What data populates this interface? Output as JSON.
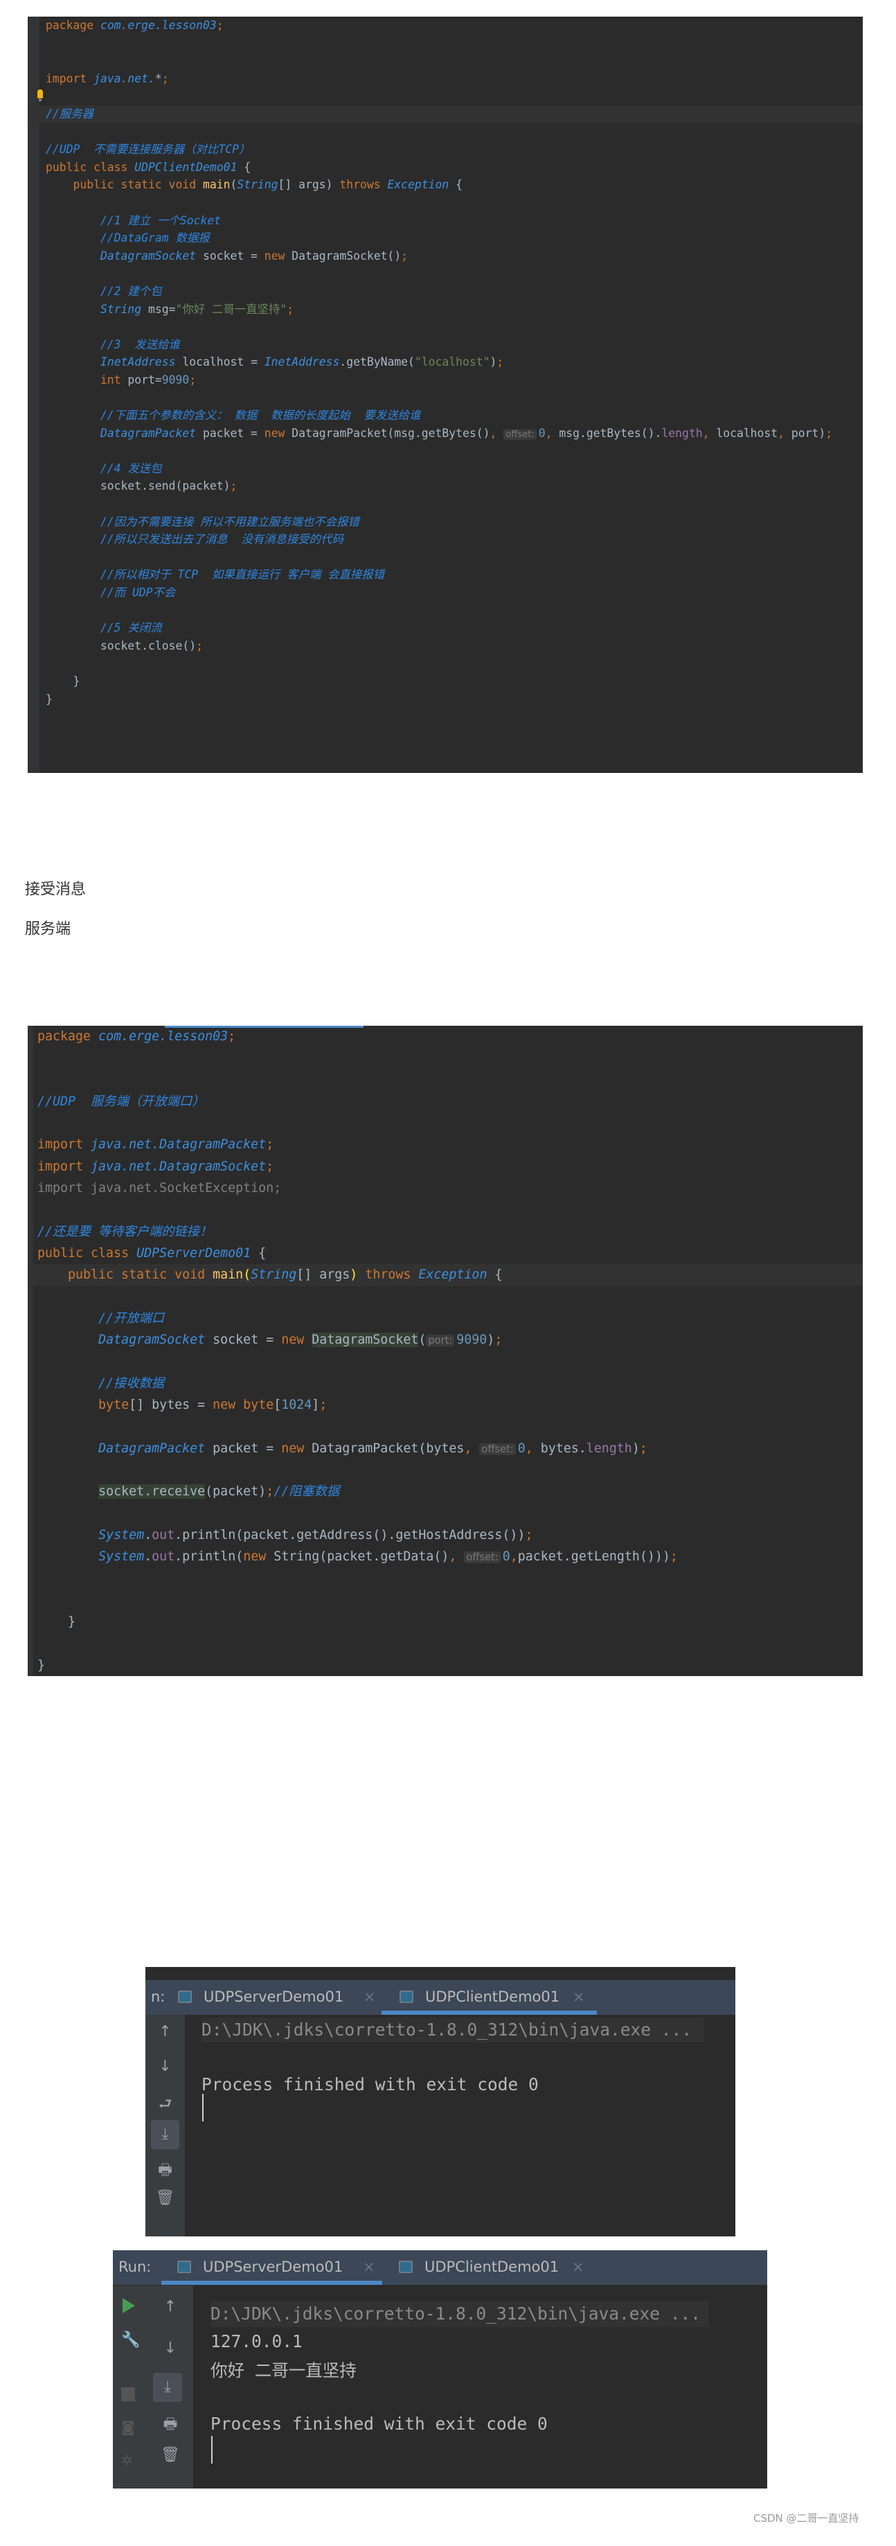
{
  "client_code": {
    "highlight_line": 5,
    "bulb_line": 4,
    "lines": [
      [
        [
          "k",
          "package "
        ],
        [
          "t",
          "com.erge.lesson03"
        ],
        [
          "sc",
          ";"
        ]
      ],
      [],
      [],
      [
        [
          "k",
          "import "
        ],
        [
          "t",
          "java.net."
        ],
        [
          "p",
          "*"
        ],
        [
          "sc",
          ";"
        ]
      ],
      [],
      [
        [
          "c",
          "//服务器"
        ]
      ],
      [],
      [
        [
          "c",
          "//UDP  不需要连接服务器（对比TCP）"
        ]
      ],
      [
        [
          "k",
          "public class "
        ],
        [
          "t",
          "UDPClientDemo01"
        ],
        [
          "p",
          " {"
        ]
      ],
      [
        [
          "k",
          "    public static void "
        ],
        [
          "m",
          "main"
        ],
        [
          "p",
          "("
        ],
        [
          "t",
          "String"
        ],
        [
          "p",
          "[] args) "
        ],
        [
          "k",
          "throws "
        ],
        [
          "t",
          "Exception"
        ],
        [
          "p",
          " {"
        ]
      ],
      [],
      [
        [
          "c",
          "        //1 建立 一个Socket"
        ]
      ],
      [
        [
          "c",
          "        //DataGram 数据报"
        ]
      ],
      [
        [
          "p",
          "        "
        ],
        [
          "t",
          "DatagramSocket"
        ],
        [
          "p",
          " socket = "
        ],
        [
          "k",
          "new "
        ],
        [
          "p",
          "DatagramSocket()"
        ],
        [
          "sc",
          ";"
        ]
      ],
      [],
      [
        [
          "c",
          "        //2 建个包"
        ]
      ],
      [
        [
          "p",
          "        "
        ],
        [
          "t",
          "String"
        ],
        [
          "p",
          " msg="
        ],
        [
          "s",
          "\"你好 二哥一直坚持\""
        ],
        [
          "sc",
          ";"
        ]
      ],
      [],
      [
        [
          "c",
          "        //3  发送给谁"
        ]
      ],
      [
        [
          "p",
          "        "
        ],
        [
          "t",
          "InetAddress"
        ],
        [
          "p",
          " localhost = "
        ],
        [
          "t",
          "InetAddress"
        ],
        [
          "p",
          ".getByName("
        ],
        [
          "s",
          "\"localhost\""
        ],
        [
          "p",
          ")"
        ],
        [
          "sc",
          ";"
        ]
      ],
      [
        [
          "k",
          "        int "
        ],
        [
          "p",
          "port="
        ],
        [
          "n",
          "9090"
        ],
        [
          "sc",
          ";"
        ]
      ],
      [],
      [
        [
          "c",
          "        //下面五个参数的含义： 数据  数据的长度起始  要发送给谁"
        ]
      ],
      [
        [
          "p",
          "        "
        ],
        [
          "t",
          "DatagramPacket"
        ],
        [
          "p",
          " packet = "
        ],
        [
          "k",
          "new "
        ],
        [
          "p",
          "DatagramPacket(msg.getBytes()"
        ],
        [
          "sc",
          ", "
        ],
        [
          "h",
          "offset:"
        ],
        [
          "n",
          "0"
        ],
        [
          "sc",
          ", "
        ],
        [
          "p",
          "msg.getBytes()."
        ],
        [
          "f",
          "length"
        ],
        [
          "sc",
          ", "
        ],
        [
          "p",
          "localhost"
        ],
        [
          "sc",
          ", "
        ],
        [
          "p",
          "port)"
        ],
        [
          "sc",
          ";"
        ]
      ],
      [],
      [
        [
          "c",
          "        //4 发送包"
        ]
      ],
      [
        [
          "p",
          "        socket.send(packet)"
        ],
        [
          "sc",
          ";"
        ]
      ],
      [],
      [
        [
          "c",
          "        //因为不需要连接 所以不用建立服务端也不会报错"
        ]
      ],
      [
        [
          "c",
          "        //所以只发送出去了消息  没有消息接受的代码"
        ]
      ],
      [],
      [
        [
          "c",
          "        //所以相对于 TCP  如果直接运行 客户端 会直接报错"
        ]
      ],
      [
        [
          "c",
          "        //而 UDP不会"
        ]
      ],
      [],
      [
        [
          "c",
          "        //5 关闭流"
        ]
      ],
      [
        [
          "p",
          "        socket.close()"
        ],
        [
          "sc",
          ";"
        ]
      ],
      [],
      [
        [
          "p",
          "    }"
        ]
      ],
      [
        [
          "p",
          "}"
        ]
      ]
    ]
  },
  "paragraphs": {
    "receive_message": "接受消息",
    "server_side": "服务端"
  },
  "server_code": {
    "highlight_line": 11,
    "lines": [
      [
        [
          "k",
          "package "
        ],
        [
          "t",
          "com.erge.lesson03"
        ],
        [
          "sc",
          ";"
        ]
      ],
      [],
      [],
      [
        [
          "c",
          "//UDP  服务端（开放端口）"
        ]
      ],
      [],
      [
        [
          "k",
          "import "
        ],
        [
          "t",
          "java.net.DatagramPacket"
        ],
        [
          "sc",
          ";"
        ]
      ],
      [
        [
          "k",
          "import "
        ],
        [
          "t",
          "java.net.DatagramSocket"
        ],
        [
          "sc",
          ";"
        ]
      ],
      [
        [
          "x",
          "import java.net.SocketException;"
        ]
      ],
      [],
      [
        [
          "c",
          "//还是要 等待客户端的链接！"
        ]
      ],
      [
        [
          "k",
          "public class "
        ],
        [
          "t",
          "UDPServerDemo01"
        ],
        [
          "p",
          " {"
        ]
      ],
      [
        [
          "k",
          "    public static void "
        ],
        [
          "m",
          "main"
        ],
        [
          "y",
          "("
        ],
        [
          "t",
          "String"
        ],
        [
          "p",
          "[] args"
        ],
        [
          "y",
          ")"
        ],
        [
          "p",
          " "
        ],
        [
          "k",
          "throws"
        ],
        [
          "p",
          " "
        ],
        [
          "t",
          "Exception"
        ],
        [
          "p",
          " {"
        ]
      ],
      [],
      [
        [
          "c",
          "        //开放端口"
        ]
      ],
      [
        [
          "p",
          "        "
        ],
        [
          "t",
          "DatagramSocket"
        ],
        [
          "p",
          " socket = "
        ],
        [
          "k",
          "new "
        ],
        [
          "p",
          "DatagramSocket"
        ],
        [
          "p",
          "("
        ],
        [
          "h",
          "port:"
        ],
        [
          "n",
          "9090"
        ],
        [
          "p",
          ")"
        ],
        [
          "sc",
          ";"
        ]
      ],
      [],
      [
        [
          "c",
          "        //接收数据"
        ]
      ],
      [
        [
          "k",
          "        byte"
        ],
        [
          "p",
          "[] bytes = "
        ],
        [
          "k",
          "new byte"
        ],
        [
          "p",
          "["
        ],
        [
          "n",
          "1024"
        ],
        [
          "p",
          "]"
        ],
        [
          "sc",
          ";"
        ]
      ],
      [],
      [
        [
          "p",
          "        "
        ],
        [
          "t",
          "DatagramPacket"
        ],
        [
          "p",
          " packet = "
        ],
        [
          "k",
          "new "
        ],
        [
          "p",
          "DatagramPacket(bytes"
        ],
        [
          "sc",
          ", "
        ],
        [
          "h",
          "offset:"
        ],
        [
          "n",
          "0"
        ],
        [
          "sc",
          ", "
        ],
        [
          "p",
          "bytes."
        ],
        [
          "f",
          "length"
        ],
        [
          "p",
          ")"
        ],
        [
          "sc",
          ";"
        ]
      ],
      [],
      [
        [
          "p",
          "        "
        ],
        [
          "p",
          "socket.receive"
        ],
        [
          "p",
          "(packet)"
        ],
        [
          "sc",
          ";"
        ],
        [
          "c",
          "//阻塞数据"
        ]
      ],
      [],
      [
        [
          "p",
          "        "
        ],
        [
          "t",
          "System"
        ],
        [
          "p",
          "."
        ],
        [
          "f",
          "out"
        ],
        [
          "p",
          ".println(packet.getAddress().getHostAddress())"
        ],
        [
          "sc",
          ";"
        ]
      ],
      [
        [
          "p",
          "        "
        ],
        [
          "t",
          "System"
        ],
        [
          "p",
          "."
        ],
        [
          "f",
          "out"
        ],
        [
          "p",
          ".println("
        ],
        [
          "k",
          "new "
        ],
        [
          "p",
          "String(packet.getData()"
        ],
        [
          "sc",
          ", "
        ],
        [
          "h",
          "offset:"
        ],
        [
          "n",
          "0"
        ],
        [
          "sc",
          ","
        ],
        [
          "p",
          "packet.getLength()))"
        ],
        [
          "sc",
          ";"
        ]
      ],
      [],
      [],
      [
        [
          "p",
          "    }"
        ]
      ],
      [],
      [
        [
          "p",
          "}"
        ]
      ]
    ]
  },
  "run_panel_client": {
    "run_label": "n:",
    "tabs": [
      {
        "label": "UDPServerDemo01",
        "close": "×",
        "active": false
      },
      {
        "label": "UDPClientDemo01",
        "close": "×",
        "active": true
      }
    ],
    "command": "D:\\JDK\\.jdks\\corretto-1.8.0_312\\bin\\java.exe ...",
    "output": [],
    "exit_message": "Process finished with exit code 0",
    "toolbar_icons": [
      "arrow-up-icon",
      "arrow-down-icon",
      "soft-wrap-icon",
      "scroll-to-end-icon",
      "print-icon",
      "trash-icon"
    ]
  },
  "run_panel_server": {
    "run_label": "Run:",
    "tabs": [
      {
        "label": "UDPServerDemo01",
        "close": "×",
        "active": true
      },
      {
        "label": "UDPClientDemo01",
        "close": "×",
        "active": false
      }
    ],
    "command": "D:\\JDK\\.jdks\\corretto-1.8.0_312\\bin\\java.exe ...",
    "output": [
      "127.0.0.1",
      "你好 二哥一直坚持"
    ],
    "exit_message": "Process finished with exit code 0",
    "colors": {
      "run": "#499c54",
      "tab_underline": "#4a88c7"
    }
  },
  "watermark": "CSDN @二哥一直坚持"
}
